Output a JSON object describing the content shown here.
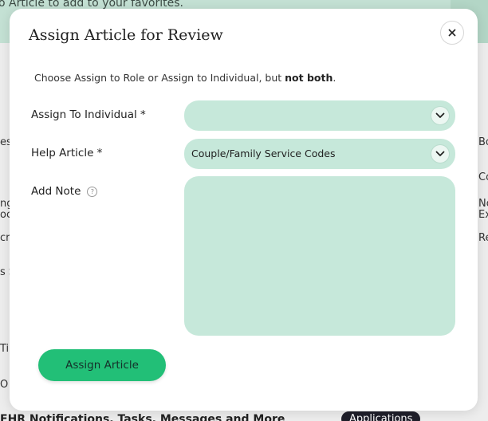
{
  "background": {
    "banner_text": "o Article to add to your favorites.",
    "left_fragments": [
      "es",
      "ng",
      "oc",
      "cri",
      "s S",
      "Ti",
      "O"
    ],
    "right_fragments": [
      "Bo",
      "Co",
      "No",
      "Ex",
      "Re"
    ],
    "bottom_text": "EHR Notifications, Tasks, Messages and More",
    "bottom_pill": "Applications"
  },
  "modal": {
    "title": "Assign Article for Review",
    "instruction_prefix": "Choose Assign to Role or Assign to Individual, but ",
    "instruction_bold": "not both",
    "instruction_suffix": ".",
    "fields": {
      "individual": {
        "label": "Assign To Individual *",
        "value": ""
      },
      "help_article": {
        "label": "Help Article *",
        "value": "Couple/Family Service Codes"
      },
      "note": {
        "label": "Add Note",
        "help_icon": "?",
        "value": ""
      }
    },
    "submit_label": "Assign Article",
    "close_icon": "close-icon"
  },
  "colors": {
    "field_bg": "#c6e8da",
    "primary": "#22bf77",
    "banner": "#c4e1d4"
  }
}
